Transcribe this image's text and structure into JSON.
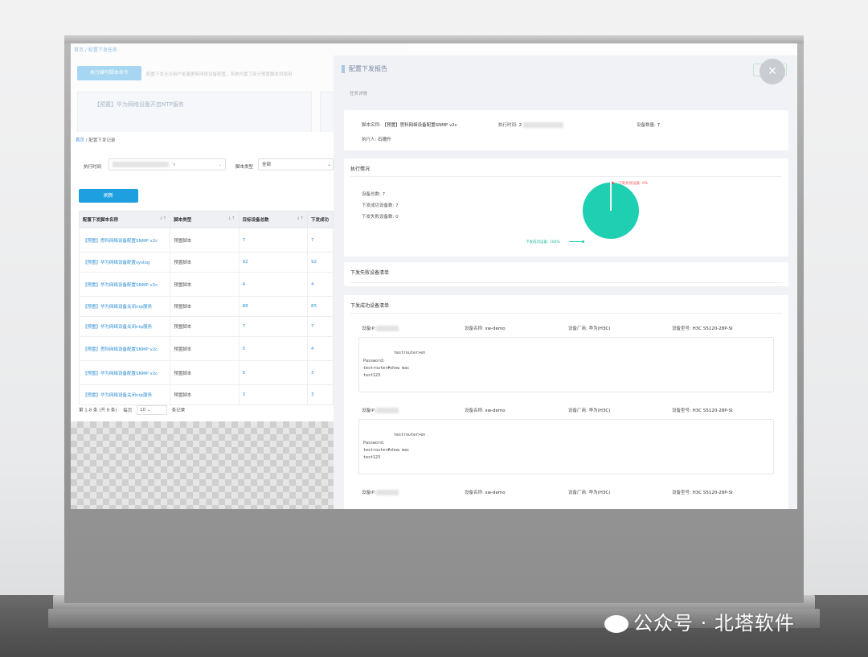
{
  "background": {
    "breadcrumb": "首页 / 配置下发任务",
    "run_button": "执行编写脚本命令",
    "description": "配置下发允许用户批量更新网络设备配置，系统内置了部分预置脚本供使用",
    "card_text": "【预置】华为网络设备开启NTP服务"
  },
  "left": {
    "breadcrumb_home": "首页",
    "breadcrumb_sep": " / ",
    "breadcrumb_current": "配置下发记录",
    "exec_time_label": "执行时间",
    "exec_time_suffix": "'s",
    "script_type_label": "脚本类型",
    "script_type_value": "全部",
    "refresh_button": "刷新",
    "columns": [
      "配置下发脚本名称",
      "脚本类型",
      "目标设备总数",
      "下发成功"
    ],
    "rows": [
      {
        "name": "【预置】思科网络设备配置SNMP v2c",
        "type": "预置脚本",
        "total": "7",
        "ok": "7"
      },
      {
        "name": "【预置】华为网络设备配置syslog",
        "type": "预置脚本",
        "total": "92",
        "ok": "92"
      },
      {
        "name": "【预置】华为网络设备配置SNMP v2c",
        "type": "预置脚本",
        "total": "4",
        "ok": "4"
      },
      {
        "name": "【预置】华为网络设备关闭ntp服务",
        "type": "预置脚本",
        "total": "88",
        "ok": "85"
      },
      {
        "name": "【预置】华为网络设备关闭ntp服务",
        "type": "预置脚本",
        "total": "7",
        "ok": "7"
      },
      {
        "name": "【预置】思科网络设备配置SNMP v2c",
        "type": "预置脚本",
        "total": "5",
        "ok": "4"
      },
      {
        "name": "【预置】华为网络设备配置SNMP v2c",
        "type": "预置脚本",
        "total": "5",
        "ok": "3"
      },
      {
        "name": "【预置】华为网络设备关闭ntp服务",
        "type": "预置脚本",
        "total": "3",
        "ok": "3"
      }
    ],
    "pager_summary": "第 1-8 条 (共 8 条)",
    "pager_per_page": "每页",
    "pager_size": "10",
    "pager_unit": "条记录"
  },
  "report": {
    "title": "配置下发报告",
    "task_section": "任务详情",
    "script_name_label": "脚本名称:",
    "script_name_value": "【预置】思科网络设备配置SNMP v2c",
    "exec_time_label": "执行时间:",
    "exec_time_value": "2",
    "device_count_label": "设备数量:",
    "device_count_value": "7",
    "executor_label": "执行人:",
    "executor_value": "石德升",
    "exec_section": "执行情况",
    "total_devices": "设备总数: 7",
    "success_devices": "下发成功设备数: 7",
    "failed_devices": "下发失败设备数: 0",
    "pie_fail_label": "下发失败设备: 0%",
    "pie_success_label": "下发成功设备: 100%",
    "fail_list_title": "下发失败设备清单",
    "success_list_title": "下发成功设备清单",
    "device_ip_label": "设备IP:",
    "device_name_label": "设备名称:",
    "device_name_value": "sw-demo",
    "vendor_label": "设备厂商:",
    "vendor_value": "华为(H3C)",
    "model_label": "设备型号:",
    "model_value": "H3C S5120-28P-SI",
    "terminal": [
      "testrouter>en",
      "Password:",
      "testrouter#show mac",
      "test123"
    ]
  },
  "colors": {
    "primary": "#1e9fe0",
    "pie_success": "#1fcfb2",
    "pie_fail": "#f05a5a"
  },
  "chart_data": {
    "type": "pie",
    "categories": [
      "下发失败设备",
      "下发成功设备"
    ],
    "values": [
      0,
      100
    ]
  },
  "watermark": "公众号 · 北塔软件"
}
